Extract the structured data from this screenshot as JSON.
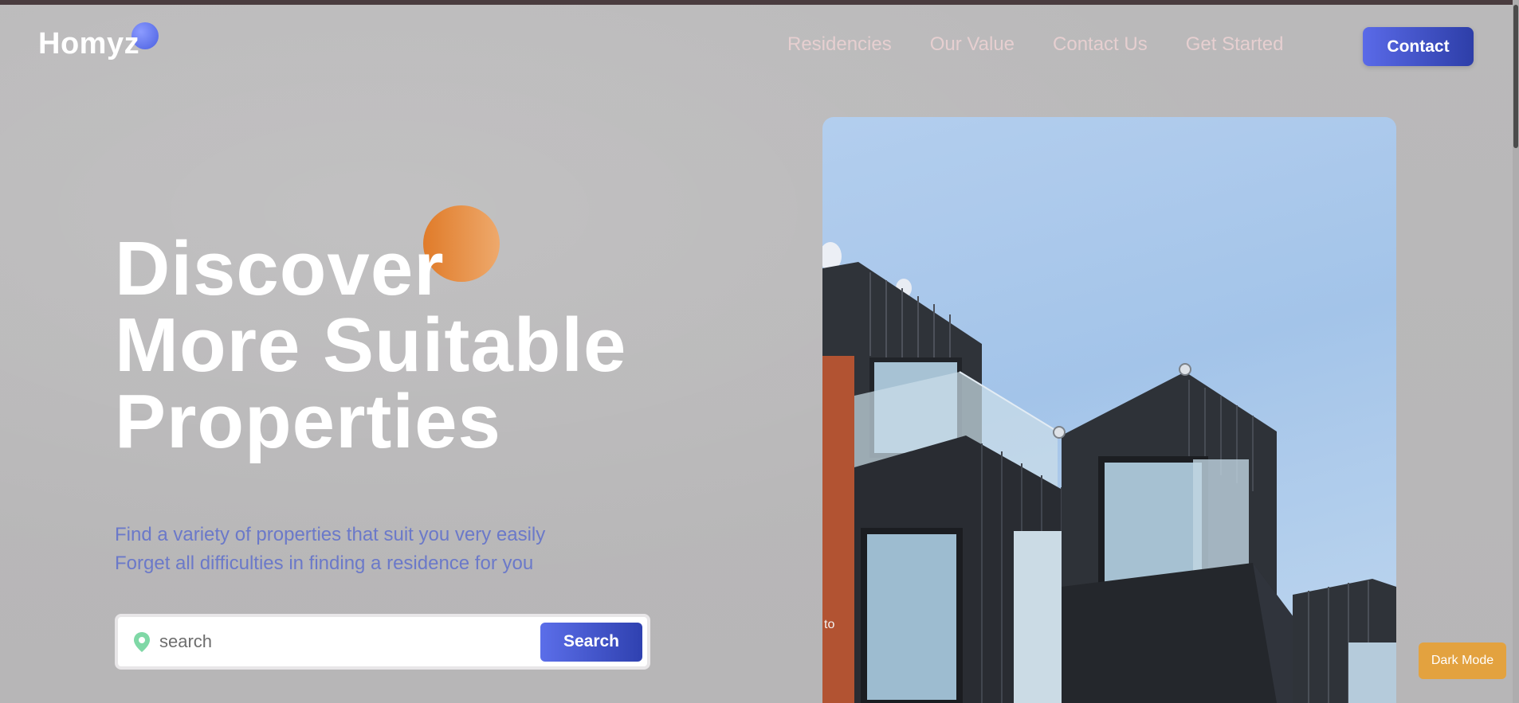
{
  "brand": {
    "name": "Homyz"
  },
  "nav": {
    "items": [
      {
        "label": "Residencies"
      },
      {
        "label": "Our Value"
      },
      {
        "label": "Contact Us"
      },
      {
        "label": "Get Started"
      }
    ],
    "contact_label": "Contact"
  },
  "hero": {
    "title_lines": [
      "Discover",
      "More Suitable",
      "Properties"
    ],
    "subtitle_lines": [
      "Find a variety of properties that suit you very easily",
      "Forget all difficulties in finding a residence for you"
    ]
  },
  "search": {
    "placeholder": "search",
    "value": "",
    "button_label": "Search"
  },
  "image": {
    "overlay_text": "to"
  },
  "theme_toggle": {
    "label": "Dark Mode"
  },
  "colors": {
    "accent_blue": "#4a5fe0",
    "accent_orange": "#e07b29",
    "subtitle_blue": "#6b79c9",
    "dark_mode_button": "#e3a23f"
  },
  "icons": {
    "logo_dot": "blue-circle",
    "search_pin": "location-pin-icon"
  }
}
